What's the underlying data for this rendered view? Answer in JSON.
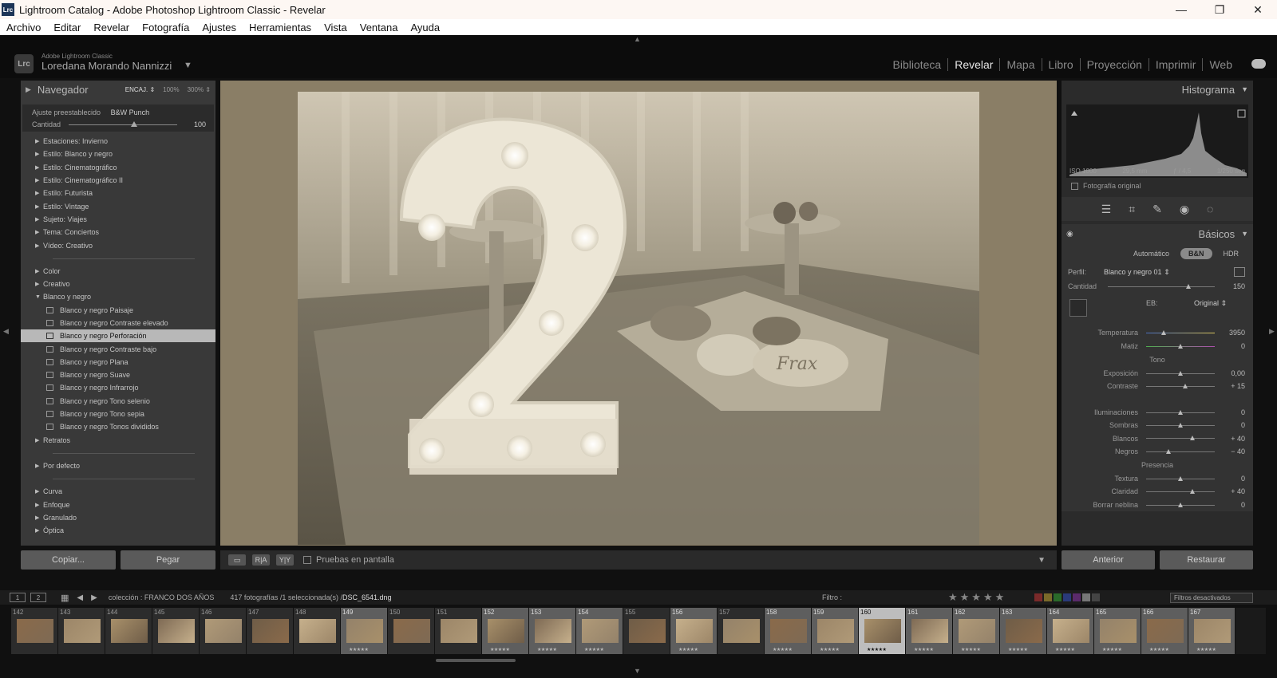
{
  "window": {
    "app_icon": "Lrc",
    "title": "Lightroom Catalog - Adobe Photoshop Lightroom Classic - Revelar",
    "controls": [
      "—",
      "❐",
      "✕"
    ]
  },
  "menu": [
    "Archivo",
    "Editar",
    "Revelar",
    "Fotografía",
    "Ajustes",
    "Herramientas",
    "Vista",
    "Ventana",
    "Ayuda"
  ],
  "identity": {
    "logo": "Lrc",
    "product": "Adobe Lightroom Classic",
    "user": "Loredana Morando Nannizzi",
    "caret": "▼"
  },
  "modules": [
    "Biblioteca",
    "Revelar",
    "Mapa",
    "Libro",
    "Proyección",
    "Imprimir",
    "Web"
  ],
  "active_module": "Revelar",
  "navigator": {
    "title": "Navegador",
    "zoom_options": [
      "ENCAJ. ⇕",
      "100%",
      "300% ⇕"
    ]
  },
  "preset_amount": {
    "label": "Ajuste preestablecido",
    "preset": "B&W Punch",
    "amount_label": "Cantidad",
    "amount_value": "100",
    "amount_fraction": 0.6
  },
  "presets": [
    {
      "type": "group",
      "label": "Estaciones: Invierno"
    },
    {
      "type": "group",
      "label": "Estilo: Blanco y negro"
    },
    {
      "type": "group",
      "label": "Estilo: Cinematográfico"
    },
    {
      "type": "group",
      "label": "Estilo: Cinematográfico II"
    },
    {
      "type": "group",
      "label": "Estilo: Futurista"
    },
    {
      "type": "group",
      "label": "Estilo: Vintage"
    },
    {
      "type": "group",
      "label": "Sujeto: Viajes"
    },
    {
      "type": "group",
      "label": "Tema: Conciertos"
    },
    {
      "type": "group",
      "label": "Vídeo: Creativo"
    },
    {
      "type": "sep"
    },
    {
      "type": "group",
      "label": "Color"
    },
    {
      "type": "group",
      "label": "Creativo"
    },
    {
      "type": "open",
      "label": "Blanco y negro"
    },
    {
      "type": "item",
      "label": "Blanco y negro Paisaje"
    },
    {
      "type": "item",
      "label": "Blanco y negro Contraste elevado"
    },
    {
      "type": "item",
      "label": "Blanco y negro Perforación",
      "selected": true
    },
    {
      "type": "item",
      "label": "Blanco y negro Contraste bajo"
    },
    {
      "type": "item",
      "label": "Blanco y negro Plana"
    },
    {
      "type": "item",
      "label": "Blanco y negro Suave"
    },
    {
      "type": "item",
      "label": "Blanco y negro Infrarrojo"
    },
    {
      "type": "item",
      "label": "Blanco y negro Tono selenio"
    },
    {
      "type": "item",
      "label": "Blanco y negro Tono sepia"
    },
    {
      "type": "item",
      "label": "Blanco y negro Tonos divididos"
    },
    {
      "type": "group",
      "label": "Retratos"
    },
    {
      "type": "sep"
    },
    {
      "type": "group",
      "label": "Por defecto"
    },
    {
      "type": "sep"
    },
    {
      "type": "group",
      "label": "Curva"
    },
    {
      "type": "group",
      "label": "Enfoque"
    },
    {
      "type": "group",
      "label": "Granulado"
    },
    {
      "type": "group",
      "label": "Óptica"
    }
  ],
  "left_buttons": {
    "copy": "Copiar...",
    "paste": "Pegar"
  },
  "toolbar": {
    "proof_label": "Pruebas en pantalla",
    "view_a": "R|A",
    "view_b": "Y|Y"
  },
  "histogram": {
    "title": "Histograma",
    "iso": "ISO 1000",
    "focal": "29,5 mm",
    "aperture": "ƒ / 4,5",
    "shutter": "1/250 seg",
    "original_label": "Fotografía original"
  },
  "basics": {
    "title": "Básicos",
    "modes": [
      "Automático",
      "B&N",
      "HDR"
    ],
    "active_mode": "B&N",
    "profile_label": "Perfil:",
    "profile_value": "Blanco y negro 01 ⇕",
    "amount_label": "Cantidad",
    "amount_value": "150",
    "amount_fraction": 0.75,
    "wb_label": "EB:",
    "wb_value": "Original ⇕",
    "sliders_wb": [
      {
        "label": "Temperatura",
        "value": "3950",
        "pos": 0.25,
        "kind": "temp"
      },
      {
        "label": "Matiz",
        "value": "0",
        "pos": 0.5,
        "kind": "tint"
      }
    ],
    "tone_title": "Tono",
    "sliders_tone": [
      {
        "label": "Exposición",
        "value": "0,00",
        "pos": 0.5
      },
      {
        "label": "Contraste",
        "value": "+ 15",
        "pos": 0.57
      },
      {
        "gap": true
      },
      {
        "label": "Iluminaciones",
        "value": "0",
        "pos": 0.5
      },
      {
        "label": "Sombras",
        "value": "0",
        "pos": 0.5
      },
      {
        "label": "Blancos",
        "value": "+ 40",
        "pos": 0.68
      },
      {
        "label": "Negros",
        "value": "− 40",
        "pos": 0.32
      }
    ],
    "presence_title": "Presencia",
    "sliders_presence": [
      {
        "label": "Textura",
        "value": "0",
        "pos": 0.5
      },
      {
        "label": "Claridad",
        "value": "+ 40",
        "pos": 0.68
      },
      {
        "label": "Borrar neblina",
        "value": "0",
        "pos": 0.5
      }
    ]
  },
  "right_buttons": {
    "previous": "Anterior",
    "reset": "Restaurar"
  },
  "filmstrip_header": {
    "page1": "1",
    "page2": "2",
    "collection": "colección : FRANCO DOS AÑOS",
    "count": "417 fotografías /1 seleccionada(s) /",
    "file": "DSC_6541.dng",
    "filter_label": "Filtro :",
    "stars": "★★★★★",
    "filter_state": "Filtros desactivados"
  },
  "filmstrip": [
    {
      "no": "142",
      "stars": ""
    },
    {
      "no": "143",
      "stars": ""
    },
    {
      "no": "144",
      "stars": ""
    },
    {
      "no": "145",
      "stars": ""
    },
    {
      "no": "146",
      "stars": ""
    },
    {
      "no": "147",
      "stars": ""
    },
    {
      "no": "148",
      "stars": ""
    },
    {
      "no": "149",
      "stars": "★★★★★"
    },
    {
      "no": "150",
      "stars": ""
    },
    {
      "no": "151",
      "stars": ""
    },
    {
      "no": "152",
      "stars": "★★★★★"
    },
    {
      "no": "153",
      "stars": "★★★★★"
    },
    {
      "no": "154",
      "stars": "★★★★★"
    },
    {
      "no": "155",
      "stars": ""
    },
    {
      "no": "156",
      "stars": "★★★★★"
    },
    {
      "no": "157",
      "stars": ""
    },
    {
      "no": "158",
      "stars": "★★★★★"
    },
    {
      "no": "159",
      "stars": "★★★★★"
    },
    {
      "no": "160",
      "stars": "★★★★★",
      "selected": true
    },
    {
      "no": "161",
      "stars": "★★★★★"
    },
    {
      "no": "162",
      "stars": "★★★★★"
    },
    {
      "no": "163",
      "stars": "★★★★★"
    },
    {
      "no": "164",
      "stars": "★★★★★"
    },
    {
      "no": "165",
      "stars": "★★★★★"
    },
    {
      "no": "166",
      "stars": "★★★★★"
    },
    {
      "no": "167",
      "stars": "★★★★★"
    }
  ],
  "colors": {
    "photo_bg": "#8a7e66",
    "panel": "#393939",
    "selected": "#b8b8b8"
  }
}
